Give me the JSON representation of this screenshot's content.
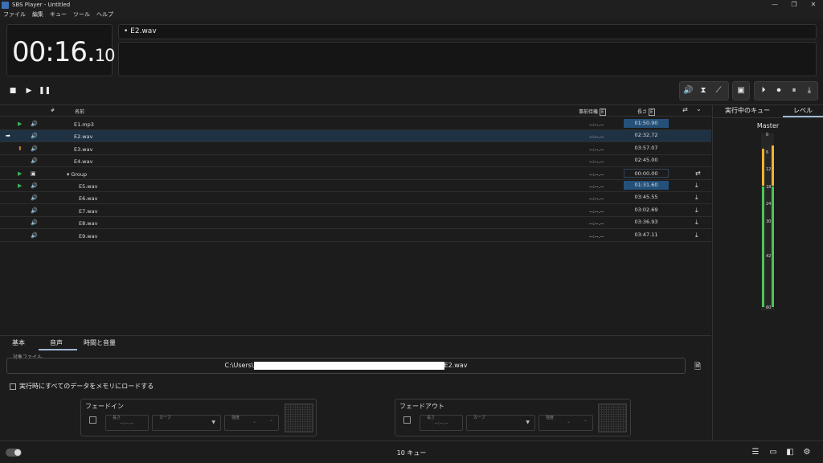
{
  "window": {
    "title": "SBS Player - Untitled",
    "controls": [
      "—",
      "❐",
      "✕"
    ]
  },
  "menu": [
    "ファイル",
    "編集",
    "キュー",
    "ツール",
    "ヘルプ"
  ],
  "timer": {
    "main": "00:16.",
    "frac": "10"
  },
  "next_cue": "• E2.wav",
  "transport": {
    "stop_icon": "■",
    "play_icon": "▶",
    "pause_icon": "❚❚"
  },
  "toolbar_icons": {
    "volume": "🔊",
    "hourglass": "⧗",
    "curve": "⟋",
    "group": "▣",
    "play_circle": "⏵",
    "stop_circle": "⏺",
    "pause_circle": "⏸",
    "download_circle": "⤓"
  },
  "table": {
    "headers": {
      "num": "#",
      "name": "名前",
      "pre_wait": "事前待機",
      "pre_wait_badge": "E",
      "duration": "長さ",
      "duration_badge": "E"
    },
    "header_icons": {
      "loop": "⇄",
      "expand": "⌄"
    },
    "rows": [
      {
        "status": "▶",
        "status_color": "#3fb34f",
        "icon": "🔊",
        "name": "E1.mp3",
        "pre": "--:--.--",
        "dur": "01:50.90",
        "dur_style": "active",
        "end": "",
        "indent": 0
      },
      {
        "status": "➡",
        "status_color": "#ffffff",
        "icon": "🔊",
        "name": "E2.wav",
        "pre": "--:--.--",
        "dur": "02:32.72",
        "dur_style": "",
        "end": "",
        "indent": 0,
        "selected": true
      },
      {
        "status": "⬆",
        "status_color": "#e8892a",
        "icon": "🔊",
        "name": "E3.wav",
        "pre": "--:--.--",
        "dur": "03:57.07",
        "dur_style": "",
        "end": "",
        "indent": 0
      },
      {
        "status": "",
        "status_color": "#ffffff",
        "icon": "🔊",
        "name": "E4.wav",
        "pre": "--:--.--",
        "dur": "02:45.00",
        "dur_style": "",
        "end": "",
        "indent": 0
      },
      {
        "status": "▶",
        "status_color": "#3fb34f",
        "icon": "▣",
        "name": "▾ Group",
        "pre": "--:--.--",
        "dur": "00:00.00",
        "dur_style": "outlined",
        "end": "⇄",
        "indent": 0
      },
      {
        "status": "▶",
        "status_color": "#3fb34f",
        "icon": "🔊",
        "name": "E5.wav",
        "pre": "--:--.--",
        "dur": "01:31.60",
        "dur_style": "active",
        "end": "⤓",
        "indent": 1
      },
      {
        "status": "",
        "status_color": "#ffffff",
        "icon": "🔊",
        "name": "E6.wav",
        "pre": "--:--.--",
        "dur": "03:45.55",
        "dur_style": "",
        "end": "⤓",
        "indent": 1
      },
      {
        "status": "",
        "status_color": "#ffffff",
        "icon": "🔊",
        "name": "E7.wav",
        "pre": "--:--.--",
        "dur": "03:02.69",
        "dur_style": "",
        "end": "⤓",
        "indent": 1
      },
      {
        "status": "",
        "status_color": "#ffffff",
        "icon": "🔊",
        "name": "E8.wav",
        "pre": "--:--.--",
        "dur": "03:36.93",
        "dur_style": "",
        "end": "⤓",
        "indent": 1
      },
      {
        "status": "",
        "status_color": "#ffffff",
        "icon": "🔊",
        "name": "E9.wav",
        "pre": "--:--.--",
        "dur": "03:47.11",
        "dur_style": "",
        "end": "⤓",
        "indent": 1
      }
    ]
  },
  "right_panel": {
    "tabs": [
      "実行中のキュー",
      "レベル"
    ],
    "meter_title": "Master",
    "scale": [
      "0",
      "6",
      "12",
      "18",
      "24",
      "30",
      "42",
      "60"
    ],
    "levels": {
      "left_db": 5,
      "right_db": 0
    }
  },
  "bottom": {
    "tabs": [
      "基本",
      "音声",
      "時間と音量"
    ],
    "file_label": "対象ファイル",
    "file_prefix": "C:\\Users\\",
    "file_suffix": "E2.wav",
    "load_label": "実行時にすべてのデータをメモリにロードする",
    "fade_in": {
      "title": "フェードイン",
      "length_label": "長さ",
      "length_value": "--:--.--",
      "curve_label": "カーブ",
      "strength_label": "強度"
    },
    "fade_out": {
      "title": "フェードアウト",
      "length_label": "長さ",
      "length_value": "--:--.--",
      "curve_label": "カーブ",
      "strength_label": "強度"
    }
  },
  "status": {
    "text": "10 キュー",
    "icons": {
      "list": "☰",
      "panel_bottom": "▭",
      "panel_right": "◧",
      "settings": "⚙"
    }
  },
  "colors": {
    "accent": "#24517a",
    "meter_green": "#4cc35a",
    "meter_yellow": "#f0b232"
  }
}
